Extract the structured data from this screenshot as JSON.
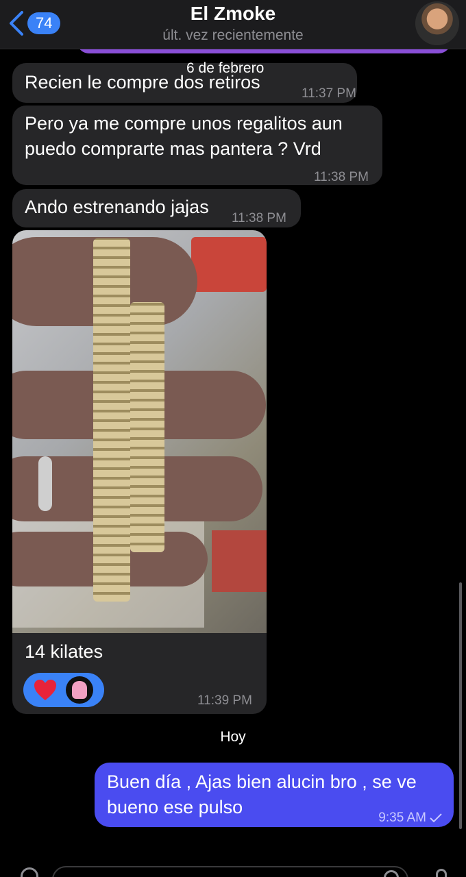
{
  "header": {
    "back_count": "74",
    "title": "El Zmoke",
    "subtitle": "últ. vez recientemente"
  },
  "messages": {
    "date_label": "6 de febrero",
    "m1": {
      "text": "Recien le compre dos retiros",
      "time": "11:37 PM"
    },
    "m2": {
      "text": "Pero ya me compre unos regalitos aun puedo comprarte mas pantera ? Vrd",
      "time": "11:38 PM"
    },
    "m3": {
      "text": "Ando estrenando jajas",
      "time": "11:38 PM"
    },
    "photo_msg": {
      "caption": "14 kilates",
      "time": "11:39 PM"
    },
    "day_label": "Hoy",
    "sent1": {
      "text": "Buen día , Ajas bien alucin bro , se ve bueno ese pulso",
      "time": "9:35 AM"
    }
  },
  "colors": {
    "sent_bubble": "#4a4cf0",
    "received_bubble": "#262628",
    "accent": "#3a82f7",
    "reaction": "heart-icon"
  }
}
